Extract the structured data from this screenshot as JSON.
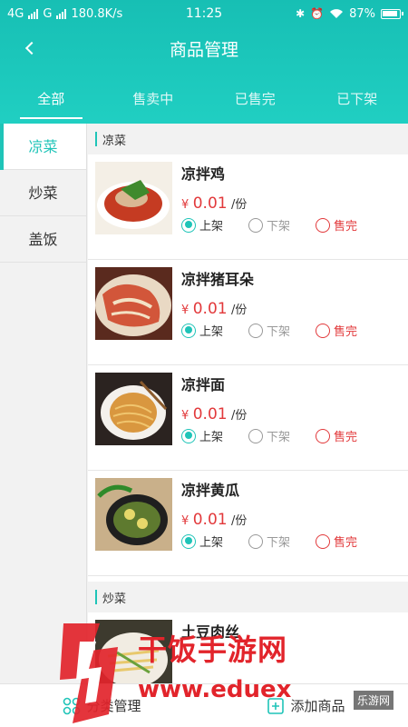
{
  "status_bar": {
    "network_left": "4G",
    "network_mid": "G",
    "speed": "180.8K/s",
    "time": "11:25",
    "battery": "87%"
  },
  "header": {
    "title": "商品管理"
  },
  "tabs": [
    {
      "label": "全部",
      "active": true
    },
    {
      "label": "售卖中",
      "active": false
    },
    {
      "label": "已售完",
      "active": false
    },
    {
      "label": "已下架",
      "active": false
    }
  ],
  "sidebar": {
    "items": [
      {
        "label": "凉菜",
        "active": true
      },
      {
        "label": "炒菜",
        "active": false
      },
      {
        "label": "盖饭",
        "active": false
      }
    ]
  },
  "categories": [
    {
      "name": "凉菜",
      "items": [
        {
          "name": "凉拌鸡",
          "currency": "¥",
          "price": "0.01",
          "unit": "/份",
          "status": "上架"
        },
        {
          "name": "凉拌猪耳朵",
          "currency": "¥",
          "price": "0.01",
          "unit": "/份",
          "status": "上架"
        },
        {
          "name": "凉拌面",
          "currency": "¥",
          "price": "0.01",
          "unit": "/份",
          "status": "上架"
        },
        {
          "name": "凉拌黄瓜",
          "currency": "¥",
          "price": "0.01",
          "unit": "/份",
          "status": "上架"
        }
      ]
    },
    {
      "name": "炒菜",
      "items": [
        {
          "name": "土豆肉丝"
        }
      ]
    }
  ],
  "options": {
    "on_shelf": "上架",
    "off_shelf": "下架",
    "sold_out": "售完"
  },
  "bottom_bar": {
    "category_manage": "分类管理",
    "add_product": "添加商品"
  },
  "watermark": {
    "text": "干饭手游网",
    "url": "www.eduex",
    "badge": "乐游网"
  },
  "colors": {
    "accent": "#1fc4b8",
    "price_red": "#e2393b"
  }
}
